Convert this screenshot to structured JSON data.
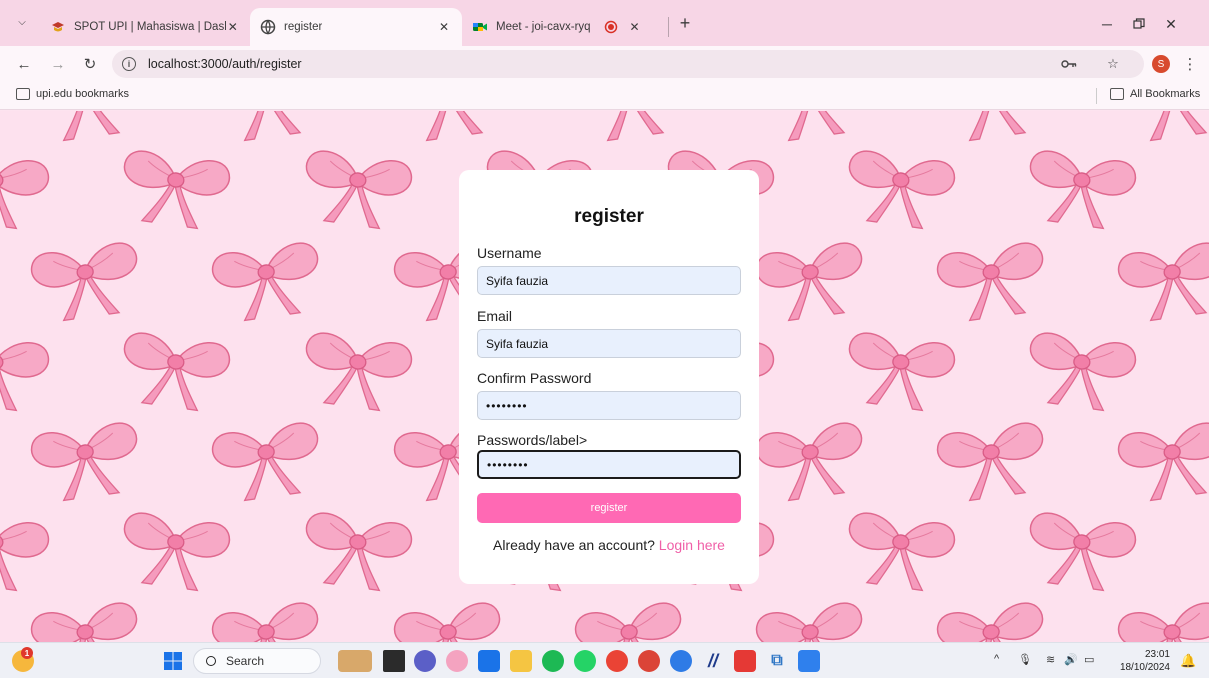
{
  "browser": {
    "tabs": [
      {
        "title": "SPOT UPI | Mahasiswa | Dashbo",
        "icon": "upi-logo-icon",
        "active": false
      },
      {
        "title": "register",
        "icon": "globe-icon",
        "active": true
      },
      {
        "title": "Meet - joi-cavx-ryq",
        "icon": "meet-icon",
        "active": false
      }
    ],
    "address": "localhost:3000/auth/register",
    "profile_initial": "S",
    "bookmarks": {
      "left": "upi.edu bookmarks",
      "right": "All Bookmarks"
    }
  },
  "form": {
    "title": "register",
    "fields": [
      {
        "label": "Username",
        "value": "Syifa fauzia"
      },
      {
        "label": "Email",
        "value": "Syifa fauzia"
      },
      {
        "label": "Confirm Password",
        "value": "••••••••"
      },
      {
        "label": "Passwords/label>",
        "value": "••••••••"
      }
    ],
    "submit_label": "register",
    "login_prompt": "Already have an account?",
    "login_link": "Login here"
  },
  "taskbar": {
    "search_label": "Search",
    "weather_badge": "1",
    "time": "23:01",
    "date": "18/10/2024"
  },
  "colors": {
    "accent_pink": "#ff69b4",
    "link_pink": "#f060a8",
    "page_bg": "#fde1ee",
    "tabstrip_bg": "#f7d6e6"
  }
}
